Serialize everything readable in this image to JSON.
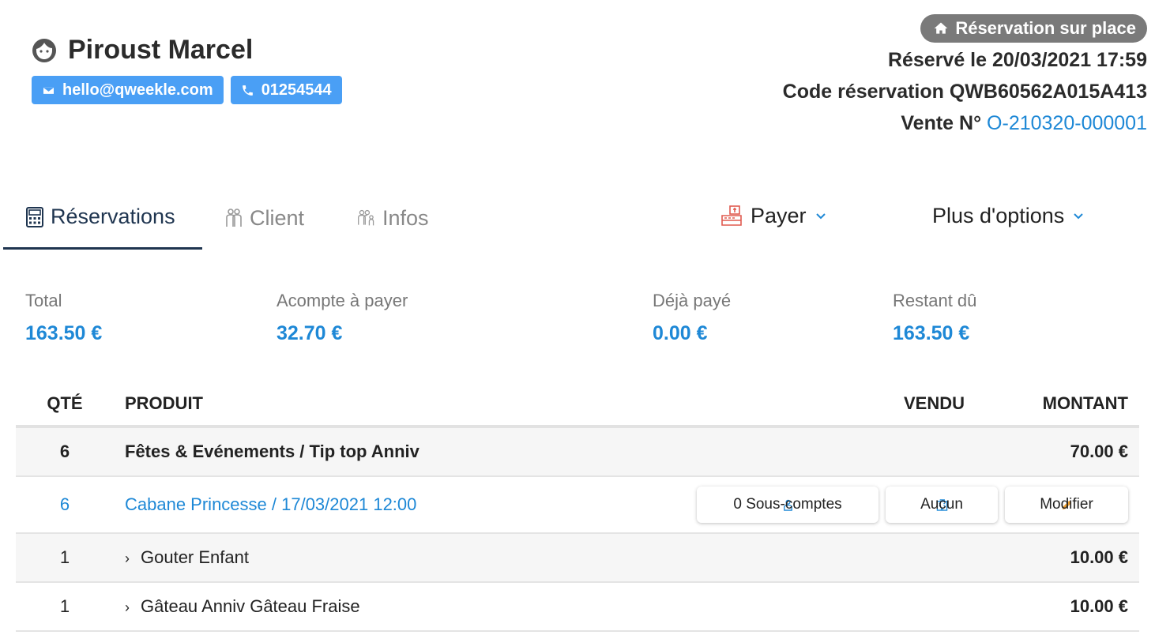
{
  "client": {
    "name": "Piroust Marcel",
    "email": "hello@qweekle.com",
    "phone": "01254544"
  },
  "header": {
    "badge": "Réservation sur place",
    "reserved_line": "Réservé le 20/03/2021 17:59",
    "code_line": "Code réservation QWB60562A015A413",
    "sale_label": "Vente N°",
    "sale_number": "O-210320-000001"
  },
  "tabs": [
    {
      "label": "Réservations",
      "icon": "calculator-icon",
      "active": true
    },
    {
      "label": "Client",
      "icon": "people-icon",
      "active": false
    },
    {
      "label": "Infos",
      "icon": "group-info-icon",
      "active": false
    }
  ],
  "actions": {
    "pay_label": "Payer",
    "options_label": "Plus d'options"
  },
  "totals": [
    {
      "label": "Total",
      "value": "163.50 €"
    },
    {
      "label": "Acompte à payer",
      "value": "32.70 €"
    },
    {
      "label": "Déjà payé",
      "value": "0.00 €"
    },
    {
      "label": "Restant dû",
      "value": "163.50 €"
    }
  ],
  "table": {
    "headers": {
      "qty": "QTÉ",
      "product": "PRODUIT",
      "sold": "VENDU",
      "amount": "MONTANT"
    },
    "rows": [
      {
        "qty": "6",
        "product": "Fêtes & Evénements / Tip top Anniv",
        "amount": "70.00 €"
      },
      {
        "qty": "6",
        "product": "Cabane Princesse / 17/03/2021 12:00",
        "amount": ""
      },
      {
        "qty": "1",
        "product": "Gouter Enfant",
        "amount": "10.00 €"
      },
      {
        "qty": "1",
        "product": "Gâteau Anniv Gâteau Fraise",
        "amount": "10.00 €"
      }
    ],
    "row_buttons": {
      "subaccounts": "0 Sous-comptes",
      "room": "Aucun",
      "edit": "Modifier"
    }
  },
  "colors": {
    "accent": "#1e88d6",
    "chip": "#4a9ff5",
    "badge": "#7a7a7a",
    "tab_active": "#1f3550"
  }
}
